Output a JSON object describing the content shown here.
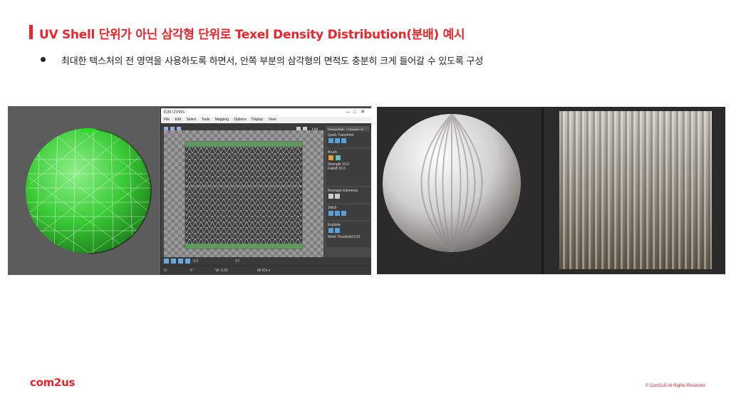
{
  "slide": {
    "title": "UV Shell 단위가 아닌 삼각형 단위로 Texel Density Distribution(분배) 예시",
    "bullet": "최대한 텍스처의 전 영역을 사용하도록 하면서, 안쪽 부분의 삼각형의 면적도 충분히 크게 들어갈 수 있도록 구성",
    "logo": "com2us",
    "copyright": "© Com2uS All Rights Reserved",
    "accent_color": "#e8262b"
  },
  "uv_editor": {
    "window_title": "Edit UVWs",
    "menu": [
      "File",
      "Edit",
      "Select",
      "Tools",
      "Mapping",
      "Options",
      "Display",
      "View"
    ],
    "checker_label": "UV",
    "checker_dropdown": "CheckerPatt... ( Checker ) ▾",
    "panel_sections": [
      "Quick Transform",
      "Reshape Elements",
      "Stitch",
      "Explode"
    ],
    "brush_section": "Brush",
    "strength_label": "Strength",
    "strength_value": "10.0",
    "falloff_label": "Falloff",
    "falloff_value": "20.0",
    "threshold_label": "Threshold",
    "threshold_value": "0.01",
    "weld_label": "Weld",
    "coord_u_label": "U:",
    "coord_v_label": "V:",
    "coord_w_label": "W:",
    "coord_w_value": "0.00",
    "zoom_value": "0.0",
    "xy_label": "XY",
    "id_label": "All IDs ▾"
  }
}
